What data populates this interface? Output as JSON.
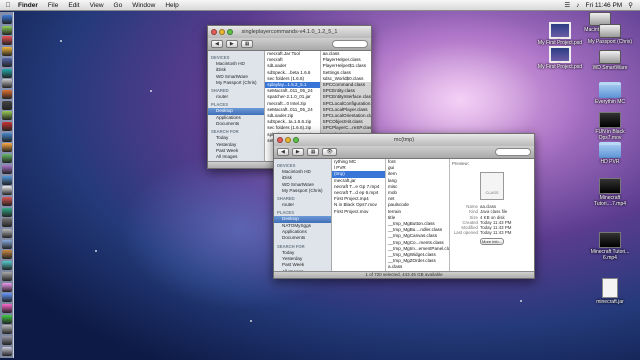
{
  "menubar": {
    "apple_icon": "apple-icon",
    "items": [
      "Finder",
      "File",
      "Edit",
      "View",
      "Go",
      "Window",
      "Help"
    ],
    "clock": "Fri 11:46 PM"
  },
  "desktop": {
    "icons": [
      {
        "label": "Macintosh HD",
        "kind": "drive"
      },
      {
        "label": "My First Project.psd",
        "kind": "screen"
      },
      {
        "label": "My Passport (Chris)",
        "kind": "drive"
      },
      {
        "label": "My First Project.psd",
        "kind": "screen"
      },
      {
        "label": "WD SmartWare",
        "kind": "drive"
      },
      {
        "label": "Everythin MC",
        "kind": "folder"
      },
      {
        "label": "FUN in Black Ops7.mov",
        "kind": "movie"
      },
      {
        "label": "HD PVR",
        "kind": "folder"
      },
      {
        "label": "Minecraft Tutori....7.mp4",
        "kind": "movie"
      },
      {
        "label": "Minecraft Tutori... 6.mp4",
        "kind": "movie"
      },
      {
        "label": "minecraft.jar",
        "kind": "doc"
      }
    ]
  },
  "win_back": {
    "title": "singleplayercommands-v4.1.0_1.2_5_1",
    "sidebar": [
      {
        "type": "head",
        "label": "DEVICES"
      },
      {
        "type": "item",
        "label": "Macintosh HD"
      },
      {
        "type": "item",
        "label": "iDisk"
      },
      {
        "type": "item",
        "label": "WD SmartWare"
      },
      {
        "type": "item",
        "label": "My Passport (Chris)"
      },
      {
        "type": "head",
        "label": "SHARED"
      },
      {
        "type": "item",
        "label": "router"
      },
      {
        "type": "head",
        "label": "PLACES"
      },
      {
        "type": "item",
        "label": "Desktop",
        "sel": true
      },
      {
        "type": "item",
        "label": "Applications"
      },
      {
        "type": "item",
        "label": "Documents"
      },
      {
        "type": "head",
        "label": "SEARCH FOR"
      },
      {
        "type": "item",
        "label": "Today"
      },
      {
        "type": "item",
        "label": "Yesterday"
      },
      {
        "type": "item",
        "label": "Past Week"
      },
      {
        "type": "item",
        "label": "All Images"
      }
    ],
    "col1": [
      "mecraft.Jar Tool",
      "mecraft",
      "sdLoader",
      "sdSpeck....beta 1.6.6",
      "sec folders (1.6.6)",
      "splaylay...1.5.2_5.1",
      "seMacraft..011_05_24",
      "spatcher-2.1.0_01.jar",
      "mecraft...0 Intel.zip",
      "seMacraft..011_05_24",
      "sdLoader.zip",
      "sdSpeck...ta.1.6.6.zip",
      "sec folders (1.6.6).zip",
      "splaylay...5.1.2_5.1.zip",
      "seMacraft...05_24"
    ],
    "col1_sel": 5,
    "col2": [
      "aa.class",
      "PlayerHelper.class",
      "PlayerHelper$1.class",
      "Settings.class",
      "sdsc_World$0.class",
      "SPCCommand.class",
      "SPCEntity.class",
      "SPCEntityInterface.class",
      "SPCLocalConfiguration.class",
      "SPCLocalPlayer.class",
      "SPCLocalOrientation.class",
      "SPCObjectHit.class",
      "SPCPlayerC...reSP.class",
      "SPCPlugin.class",
      "SPCPluginManager.class"
    ],
    "col2_grey": [
      5,
      6,
      7,
      8,
      9,
      10,
      11,
      12,
      13,
      14
    ]
  },
  "win_front": {
    "title": "mc(tmp)",
    "sidebar": [
      {
        "type": "head",
        "label": "DEVICES"
      },
      {
        "type": "item",
        "label": "Macintosh HD"
      },
      {
        "type": "item",
        "label": "iDisk"
      },
      {
        "type": "item",
        "label": "WD SmartWare"
      },
      {
        "type": "item",
        "label": "My Passport (Chris)"
      },
      {
        "type": "head",
        "label": "SHARED"
      },
      {
        "type": "item",
        "label": "router"
      },
      {
        "type": "head",
        "label": "PLACES"
      },
      {
        "type": "item",
        "label": "Desktop",
        "sel": true
      },
      {
        "type": "item",
        "label": "NATOMySggs"
      },
      {
        "type": "item",
        "label": "Applications"
      },
      {
        "type": "item",
        "label": "Documents"
      },
      {
        "type": "head",
        "label": "SEARCH FOR"
      },
      {
        "type": "item",
        "label": "Today"
      },
      {
        "type": "item",
        "label": "Yesterday"
      },
      {
        "type": "item",
        "label": "Past Week"
      },
      {
        "type": "item",
        "label": "All Images"
      }
    ],
    "col1": [
      "rything MC",
      "l PVR",
      "(tmp)",
      "mecraft.jar",
      "necraft T...e Gp 7.mp4",
      "necraft T...d ep 6.mp4",
      "First Project.mp4",
      "N in Black Ops7.mov",
      "First Project.mov"
    ],
    "col1_sel": 2,
    "col2": [
      "font",
      "gui",
      "item",
      "lang",
      "misc",
      "mob",
      "net",
      "paulscode",
      "terrain",
      "title",
      "__tmp_MgButton.class",
      "__tmp_MgBu....ndler.class",
      "__tmp_MgCanvas.class",
      "__tmp_MgCo...ments.class",
      "__tmp_MgIm...ementPanel.class",
      "__tmp_MgWidget.class",
      "__tmp_MgZOrder.class",
      "a.class",
      "aa.class"
    ],
    "col2_sel": 18,
    "preview": {
      "header": "Preview:",
      "icon_text": "CLASS",
      "fields": [
        {
          "k": "Name",
          "v": "aa.class"
        },
        {
          "k": "Kind",
          "v": "Java class file"
        },
        {
          "k": "Size",
          "v": "4 KB on disk"
        },
        {
          "k": "Created",
          "v": "Today 11:43 PM"
        },
        {
          "k": "Modified",
          "v": "Today 11:43 PM"
        },
        {
          "k": "Last opened",
          "v": "Today 11:43 PM"
        }
      ],
      "more_button": "More info..."
    },
    "status": "1 of 720 selected, 443.45 GB available"
  }
}
